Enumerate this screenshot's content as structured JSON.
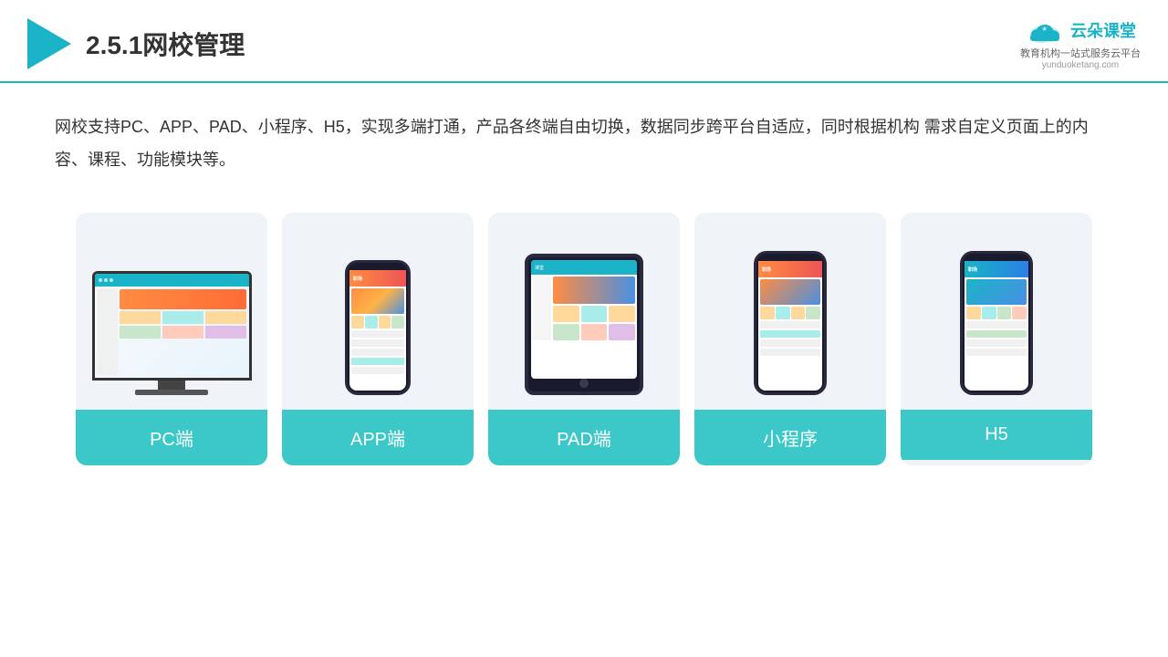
{
  "header": {
    "title": "2.5.1网校管理",
    "brand_name": "云朵课堂",
    "brand_url": "yunduoketang.com",
    "brand_tagline": "教育机构一站\n式服务云平台"
  },
  "description": "网校支持PC、APP、PAD、小程序、H5，实现多端打通，产品各终端自由切换，数据同步跨平台自适应，同时根据机构\n需求自定义页面上的内容、课程、功能模块等。",
  "devices": [
    {
      "id": "pc",
      "label": "PC端"
    },
    {
      "id": "app",
      "label": "APP端"
    },
    {
      "id": "pad",
      "label": "PAD端"
    },
    {
      "id": "miniprogram",
      "label": "小程序"
    },
    {
      "id": "h5",
      "label": "H5"
    }
  ],
  "colors": {
    "teal": "#3cc8c8",
    "accent": "#1ab3c8",
    "text_dark": "#333333",
    "bg_card": "#f0f4f8"
  }
}
